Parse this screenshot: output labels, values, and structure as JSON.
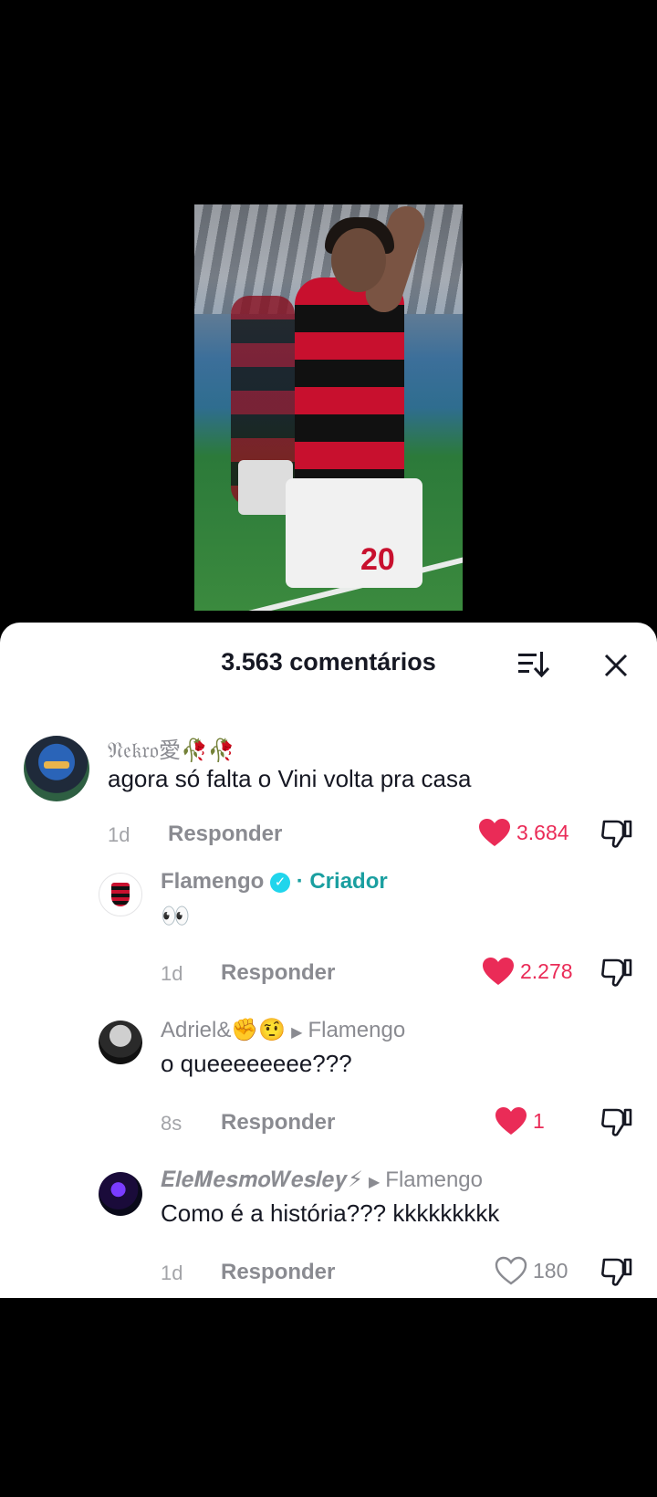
{
  "sheet": {
    "title": "3.563 comentários"
  },
  "colors": {
    "like_active": "#ea2b57",
    "creator": "#1a9fa0",
    "verified": "#20d5ec"
  },
  "comments": [
    {
      "username": "𝔑𝔢𝔨𝔯𝔬愛🥀🥀",
      "text": "agora só falta o Vini volta pra casa",
      "time": "1d",
      "reply": "Responder",
      "likes": "3.684",
      "liked": true
    },
    {
      "username": "Flamengo",
      "badge": "· Criador",
      "text": "👀",
      "time": "1d",
      "reply": "Responder",
      "likes": "2.278",
      "liked": true
    },
    {
      "username": "Adriel&✊🤨",
      "reply_to": "Flamengo",
      "text": "o queeeeeeee???",
      "time": "8s",
      "reply": "Responder",
      "likes": "1",
      "liked": true
    },
    {
      "username": "𝑬𝒍𝒆𝑴𝒆𝒔𝒎𝒐𝑾𝒆𝒔𝒍𝒆𝒚⚡",
      "reply_to": "Flamengo",
      "text": "Como é a história??? kkkkkkkkk",
      "time": "1d",
      "reply": "Responder",
      "likes": "180",
      "liked": false
    }
  ]
}
